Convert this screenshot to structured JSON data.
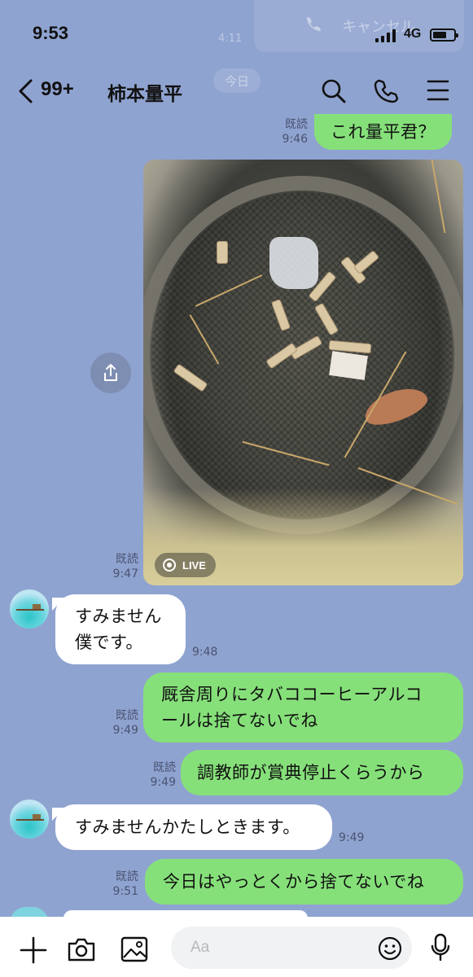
{
  "status_bar": {
    "time": "9:53",
    "network": "4G"
  },
  "ghost": {
    "cancel": "キャンセル",
    "time": "4:11",
    "date": "今日"
  },
  "header": {
    "back_count": "99+",
    "title": "柿本量平"
  },
  "messages": [
    {
      "dir": "sent",
      "lines": [
        "これ量平君？"
      ],
      "read": "既読",
      "time": "9:46"
    },
    {
      "dir": "sent",
      "type": "photo",
      "badge": "LIVE",
      "read": "既読",
      "time": "9:47"
    },
    {
      "dir": "recv",
      "lines": [
        "すみません",
        "僕です。"
      ],
      "time": "9:48"
    },
    {
      "dir": "sent",
      "lines": [
        "厩舎周りにタバココーヒーアルコ",
        "ールは捨てないでね"
      ],
      "read": "既読",
      "time": "9:49"
    },
    {
      "dir": "sent",
      "lines": [
        "調教師が賞典停止くらうから"
      ],
      "read": "既読",
      "time": "9:49"
    },
    {
      "dir": "recv",
      "lines": [
        "すみませんかたしときます。"
      ],
      "time": "9:49"
    },
    {
      "dir": "sent",
      "lines": [
        "今日はやっとくから捨てないでね"
      ],
      "read": "既読",
      "time": "9:51"
    }
  ],
  "input": {
    "placeholder": "Aa",
    "value": ""
  },
  "icons": {
    "back": "chevron-left-icon",
    "search": "search-icon",
    "call": "phone-icon",
    "menu": "hamburger-menu-icon",
    "share": "share-icon",
    "plus": "plus-icon",
    "camera": "camera-icon",
    "image": "image-icon",
    "emoji": "emoji-icon",
    "mic": "microphone-icon"
  },
  "colors": {
    "background": "#8fa3d0",
    "sent_bubble": "#86e07a",
    "recv_bubble": "#ffffff"
  }
}
